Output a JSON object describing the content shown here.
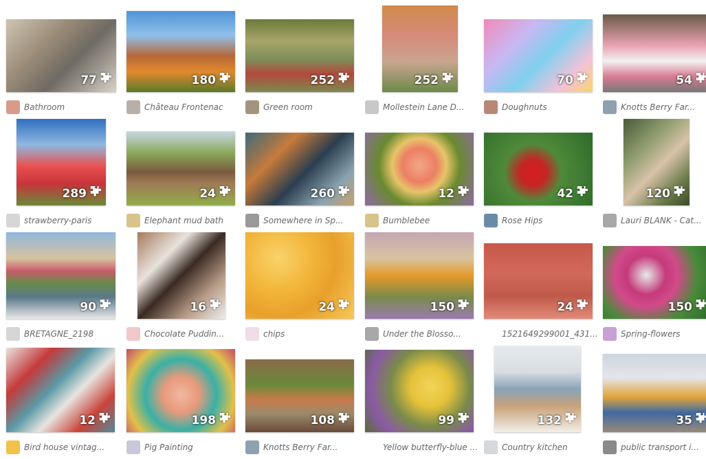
{
  "puzzles": [
    {
      "title": "Bathroom",
      "pieces": "77",
      "bg": "linear-gradient(135deg,#cfc4b3 0%,#9a8c78 35%,#6e6a63 60%,#d9d2c6 100%)",
      "avatar": "#d99a8c"
    },
    {
      "title": "Château Frontenac",
      "pieces": "180",
      "bg": "linear-gradient(180deg,#4f93d6 0%,#8fc0ea 30%,#b5683a 55%,#e2892d 75%,#5b7a2b 100%)",
      "avatar": "#b8b0a8"
    },
    {
      "title": "Green room",
      "pieces": "252",
      "bg": "linear-gradient(180deg,#6c7a3a 0%,#a7a56a 30%,#7e8e5a 55%,#b3493c 75%,#7d8a4e 100%)",
      "avatar": "#a4947e"
    },
    {
      "title": "Mollestein Lane D...",
      "pieces": "252",
      "bg": "linear-gradient(180deg,#cf8a4a 0%,#d68a7a 35%,#c9a58f 65%,#6b8a4a 100%)",
      "avatar": "#c8c8c8"
    },
    {
      "title": "Doughnuts",
      "pieces": "70",
      "bg": "linear-gradient(135deg,#f18ab8 0%,#c9b7f2 30%,#7fd0ee 55%,#f4c2d9 80%,#f7d46a 100%)",
      "avatar": "#b88778"
    },
    {
      "title": "Knotts Berry Far...",
      "pieces": "54",
      "bg": "linear-gradient(180deg,#6b5a48 0%,#e8a1b2 40%,#f2f2f2 60%,#d87c93 80%,#777 100%)",
      "avatar": "#8fa0b0"
    },
    {
      "title": "strawberry-paris",
      "pieces": "289",
      "bg": "linear-gradient(180deg,#2f6fbf 0%,#8fb8df 30%,#e8504f 55%,#c7343a 75%,#6a8a3a 100%)",
      "avatar": "#d6d6d6"
    },
    {
      "title": "Elephant mud bath",
      "pieces": "24",
      "bg": "linear-gradient(180deg,#c7d8e3 0%,#8aa75a 30%,#7a5a3e 55%,#9f7a55 70%,#8fae4a 100%)",
      "avatar": "#d7c48a"
    },
    {
      "title": "Somewhere in Sp...",
      "pieces": "260",
      "bg": "linear-gradient(135deg,#3e6a7a 0%,#c77a3a 30%,#2a3e4f 55%,#8aa3b0 80%,#c7a26a 100%)",
      "avatar": "#9a9a9a"
    },
    {
      "title": "Bumblebee",
      "pieces": "12",
      "bg": "radial-gradient(circle at 50% 45%,#f2a88a 0%,#ec7f63 25%,#e7c46a 40%,#6a8a2f 60%,#8d6aa6 100%)",
      "avatar": "#d7c48a"
    },
    {
      "title": "Rose Hips",
      "pieces": "42",
      "bg": "radial-gradient(circle at 45% 55%,#d3201f 0%,#c62425 18%,#4f8a3a 40%,#2e6a2a 100%)",
      "avatar": "#6a8aa6"
    },
    {
      "title": "Lauri BLANK - Cat...",
      "pieces": "120",
      "bg": "linear-gradient(135deg,#4a5a3a 0%,#8a9a6a 30%,#d8c2a8 55%,#6a7a4a 80%,#3a4a2a 100%)",
      "avatar": "#a8a8a8"
    },
    {
      "title": "BRETAGNE_2198",
      "pieces": "90",
      "bg": "linear-gradient(180deg,#8fb7dd 0%,#d7c3a0 30%,#c95a6a 45%,#6a8a4a 58%,#5a7a8a 75%,#e8e8e8 100%)",
      "avatar": "#d6d6d6"
    },
    {
      "title": "Chocolate Puddin...",
      "pieces": "16",
      "bg": "linear-gradient(135deg,#a57a5e 0%,#e9e3dd 30%,#3a2a22 50%,#b79b86 75%,#eee 100%)",
      "avatar": "#f0c9c9"
    },
    {
      "title": "chips",
      "pieces": "24",
      "bg": "radial-gradient(circle at 30% 30%,#f9d36a 0%,#f2b53a 35%,#e8a02a 60%,#f6c85a 100%)",
      "avatar": "#f0dde8"
    },
    {
      "title": "Under the Blosso...",
      "pieces": "150",
      "bg": "linear-gradient(180deg,#c4a6b5 0%,#d7c4a0 30%,#e59a2a 50%,#7a8a4a 75%,#9a7ab0 100%)",
      "avatar": "#a8a8a8"
    },
    {
      "title": "1521649299001_431...",
      "pieces": "24",
      "bg": "linear-gradient(180deg,#c75a4a 0%,#d2685a 40%,#bf5a4a 70%,#e38a7a 100%)",
      "avatar": "#ffffff"
    },
    {
      "title": "Spring-flowers",
      "pieces": "150",
      "bg": "radial-gradient(circle at 40% 40%,#e9e9ea 0%,#c43a7a 25%,#d24a8a 40%,#4a8a3a 65%,#2a6a2a 100%)",
      "avatar": "#c8a0d6"
    },
    {
      "title": "Bird house vintag...",
      "pieces": "12",
      "bg": "linear-gradient(135deg,#e8e4e0 0%,#c43a3a 25%,#5a9aa6 45%,#e8e4e0 60%,#c9443a 80%,#4f8a9a 100%)",
      "avatar": "#f2c24a"
    },
    {
      "title": "Pig Painting",
      "pieces": "198",
      "bg": "radial-gradient(circle at 50% 55%,#f0b7a2 0%,#e89a7a 25%,#3ab0a6 50%,#e2c04a 75%,#c44a6a 100%)",
      "avatar": "#c8c8d8"
    },
    {
      "title": "Knotts Berry Far...",
      "pieces": "108",
      "bg": "linear-gradient(180deg,#8a6a4a 0%,#6a8a3a 35%,#c97a4a 55%,#9a8a6a 75%,#6a4a3a 100%)",
      "avatar": "#8fa0b0"
    },
    {
      "title": "Yellow butterfly-blue ...",
      "pieces": "99",
      "bg": "radial-gradient(circle at 60% 45%,#f2d45a 0%,#e6c23a 25%,#7a8a4a 50%,#8a5aa6 75%,#5a6a3a 100%)",
      "avatar": "#ffffff"
    },
    {
      "title": "Country kitchen",
      "pieces": "132",
      "bg": "linear-gradient(180deg,#e6ebef 0%,#d8dde2 30%,#8aa3b8 50%,#c9a27a 70%,#f2efe9 100%)",
      "avatar": "#d2d8dc"
    },
    {
      "title": "public transport i...",
      "pieces": "35",
      "bg": "linear-gradient(180deg,#cdd5df 0%,#e3e6ea 30%,#e2a43a 55%,#3e6aa3 75%,#9a8a7a 100%)",
      "avatar": "#8a8a8a"
    }
  ]
}
